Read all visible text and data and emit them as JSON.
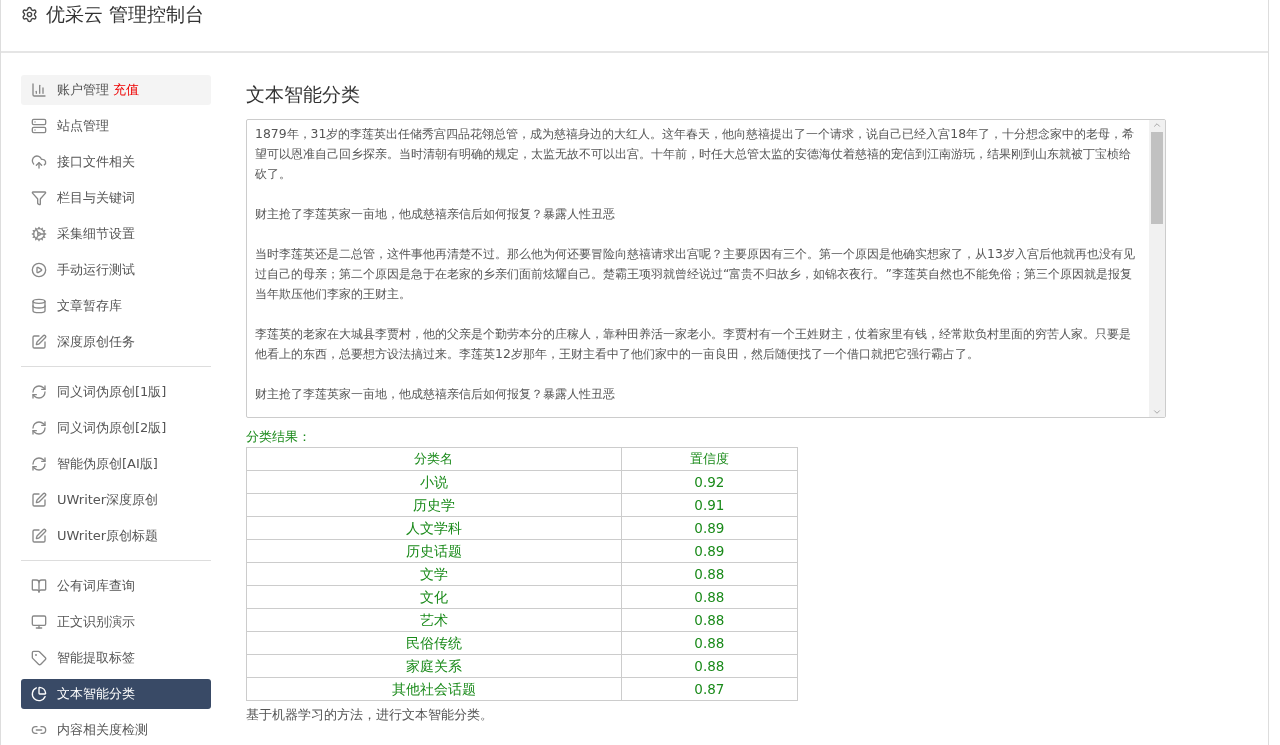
{
  "header": {
    "title": "优采云 管理控制台"
  },
  "sidebar": {
    "groups": [
      {
        "items": [
          {
            "label": "账户管理",
            "badge": "充值",
            "selected": false
          },
          {
            "label": "站点管理",
            "selected": false
          },
          {
            "label": "接口文件相关",
            "selected": false
          },
          {
            "label": "栏目与关键词",
            "selected": false
          },
          {
            "label": "采集细节设置",
            "selected": false
          },
          {
            "label": "手动运行测试",
            "selected": false
          },
          {
            "label": "文章暂存库",
            "selected": false
          },
          {
            "label": "深度原创任务",
            "selected": false
          }
        ]
      },
      {
        "items": [
          {
            "label": "同义词伪原创[1版]",
            "selected": false
          },
          {
            "label": "同义词伪原创[2版]",
            "selected": false
          },
          {
            "label": "智能伪原创[AI版]",
            "selected": false
          },
          {
            "label": "UWriter深度原创",
            "selected": false
          },
          {
            "label": "UWriter原创标题",
            "selected": false
          }
        ]
      },
      {
        "items": [
          {
            "label": "公有词库查询",
            "selected": false
          },
          {
            "label": "正文识别演示",
            "selected": false
          },
          {
            "label": "智能提取标签",
            "selected": false
          },
          {
            "label": "文本智能分类",
            "selected": true
          },
          {
            "label": "内容相关度检测",
            "selected": false
          }
        ]
      }
    ]
  },
  "main": {
    "title": "文本智能分类",
    "text_area": {
      "paragraphs": [
        "1879年，31岁的李莲英出任储秀宫四品花翎总管，成为慈禧身边的大红人。这年春天，他向慈禧提出了一个请求，说自己已经入宫18年了，十分想念家中的老母，希望可以恩准自己回乡探亲。当时清朝有明确的规定，太监无故不可以出宫。十年前，时任大总管太监的安德海仗着慈禧的宠信到江南游玩，结果刚到山东就被丁宝桢给砍了。",
        "财主抢了李莲英家一亩地，他成慈禧亲信后如何报复？暴露人性丑恶",
        "当时李莲英还是二总管，这件事他再清楚不过。那么他为何还要冒险向慈禧请求出宫呢？主要原因有三个。第一个原因是他确实想家了，从13岁入宫后他就再也没有见过自己的母亲；第二个原因是急于在老家的乡亲们面前炫耀自己。楚霸王项羽就曾经说过“富贵不归故乡，如锦衣夜行。”李莲英自然也不能免俗；第三个原因就是报复当年欺压他们李家的王财主。",
        "李莲英的老家在大城县李贾村，他的父亲是个勤劳本分的庄稼人，靠种田养活一家老小。李贾村有一个王姓财主，仗着家里有钱，经常欺负村里面的穷苦人家。只要是他看上的东西，总要想方设法搞过来。李莲英12岁那年，王财主看中了他们家中的一亩良田，然后随便找了一个借口就把它强行霸占了。",
        "财主抢了李莲英家一亩地，他成慈禧亲信后如何报复？暴露人性丑恶"
      ]
    },
    "result_label": "分类结果：",
    "table": {
      "columns": [
        "分类名",
        "置信度"
      ],
      "rows": [
        [
          "小说",
          "0.92"
        ],
        [
          "历史学",
          "0.91"
        ],
        [
          "人文学科",
          "0.89"
        ],
        [
          "历史话题",
          "0.89"
        ],
        [
          "文学",
          "0.88"
        ],
        [
          "文化",
          "0.88"
        ],
        [
          "艺术",
          "0.88"
        ],
        [
          "民俗传统",
          "0.88"
        ],
        [
          "家庭关系",
          "0.88"
        ],
        [
          "其他社会话题",
          "0.87"
        ]
      ]
    },
    "footnote": "基于机器学习的方法，进行文本智能分类。"
  }
}
